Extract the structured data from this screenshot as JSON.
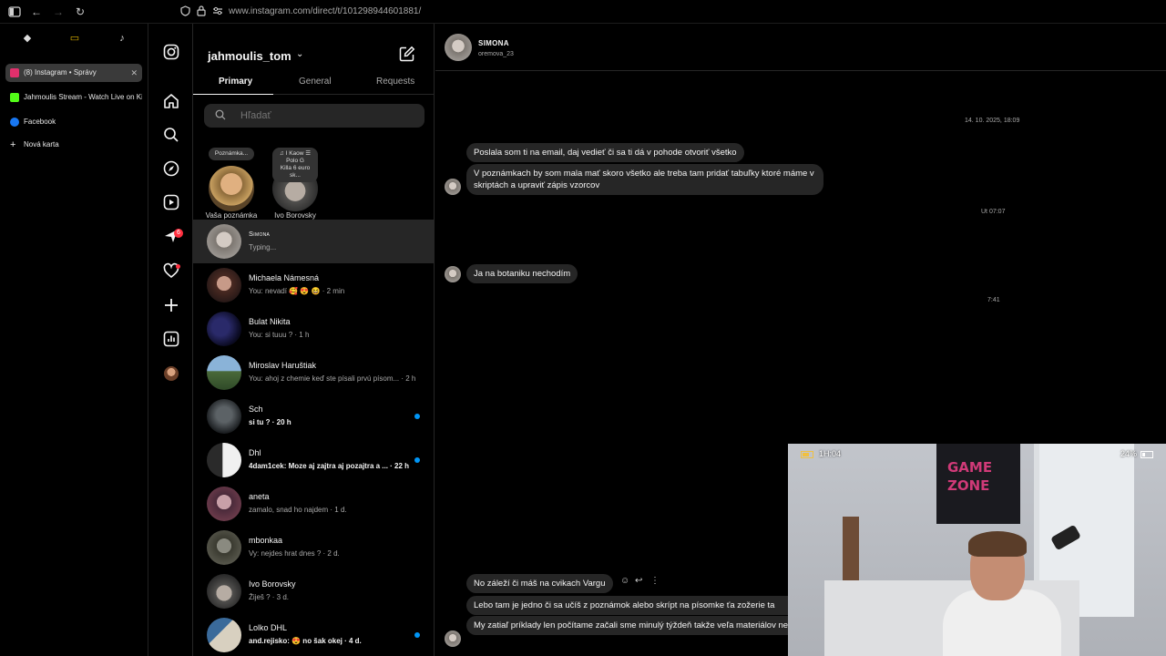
{
  "browser": {
    "url": "www.instagram.com/direct/t/101298944601881/",
    "pins": [
      "◆",
      "▭",
      "♪"
    ],
    "tabs": [
      {
        "title": "(8) Instagram • Správy",
        "active": true,
        "favicon_color": "#e1306c"
      },
      {
        "title": "Jahmoulis Stream - Watch Live on Kick",
        "active": false,
        "favicon_color": "#53fc18"
      },
      {
        "title": "Facebook",
        "active": false,
        "favicon_color": "#1877f2"
      },
      {
        "title": "Nová karta",
        "active": false,
        "favicon_color": ""
      }
    ],
    "new_tab_icon": "+"
  },
  "rail": {
    "items": [
      "instagram-logo-icon",
      "home-icon",
      "search-icon",
      "explore-icon",
      "reels-icon",
      "messages-icon",
      "notifications-icon",
      "create-icon",
      "dashboard-icon",
      "profile-avatar"
    ],
    "messages_badge": "6"
  },
  "inbox": {
    "account": "jahmoulis_tom",
    "tabs": [
      "Primary",
      "General",
      "Requests"
    ],
    "search_placeholder": "Hľadať",
    "notes": [
      {
        "bubble": "Poznámka...",
        "label": "Vaša poznámka"
      },
      {
        "bubble": "♫ I Kaow ☰\nPolo G\nKilla 6 euro sk...",
        "label": "Ivo Borovsky"
      }
    ],
    "conversations": [
      {
        "name": "Simona",
        "preview": "Typing...",
        "unread": false,
        "selected": true
      },
      {
        "name": "Michaela Námesná",
        "preview": "You: nevadí 🥰 😍 😆 · 2 min",
        "unread": false
      },
      {
        "name": "Bulat Nikita",
        "preview": "You: si tuuu ? · 1 h",
        "unread": false
      },
      {
        "name": "Miroslav Haruštiak",
        "preview": "You: ahoj z chemie keď ste písali prvú písom... · 2 h",
        "unread": false
      },
      {
        "name": "Sch",
        "preview": "si tu ? · 20 h",
        "unread": true
      },
      {
        "name": "Dhl",
        "preview": "4dam1cek: Moze aj zajtra aj pozajtra a ... · 22 h",
        "unread": true
      },
      {
        "name": "aneta",
        "preview": "zamalo, snad ho najdem · 1 d.",
        "unread": false
      },
      {
        "name": "mbonkaa",
        "preview": "Vy: nejdes hrat dnes ? · 2 d.",
        "unread": false
      },
      {
        "name": "Ivo Borovsky",
        "preview": "Žiješ ? · 3 d.",
        "unread": false
      },
      {
        "name": "Lolko DHL",
        "preview": "and.rejisko: 😍 no šak okej · 4 d.",
        "unread": true
      }
    ]
  },
  "chat": {
    "contact_name": "SIMONA",
    "contact_username": "oremova_23",
    "timestamps": [
      "14. 10. 2025, 18:09",
      "Ut 07:07",
      "7:41"
    ],
    "messages": [
      "Poslala som ti na email, daj vedieť či sa ti dá v pohode otvoriť všetko",
      "V poznámkach by som mala mať skoro všetko ale treba tam pridať tabuľky ktoré máme v skriptách a upraviť zápis vzorcov",
      "Ja na botaniku nechodím",
      "No záleží či máš na cvikach Vargu",
      "Lebo tam je jedno či sa učíš z poznámok alebo skrípt na písomke ťa zožerie ta",
      "My zatiaľ príklady len počítame začali sme minulý týždeň takže veľa materiálov nemám"
    ],
    "message_actions": [
      "☺",
      "↩",
      "⋮"
    ]
  },
  "webcam": {
    "time_hud": "1H:04",
    "battery_hud": "24%",
    "poster_text": "GAME ZONE"
  }
}
